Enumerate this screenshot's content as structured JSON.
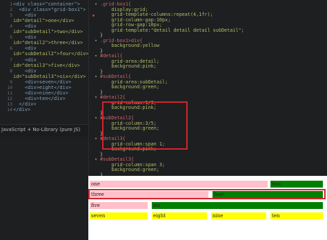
{
  "html_editor": {
    "lines": [
      {
        "n": "1",
        "text": "<div class=\"container\">"
      },
      {
        "n": "2",
        "text": "  <div class=\"grid-box1\">"
      },
      {
        "n": "3",
        "text": "    <div"
      },
      {
        "n": "",
        "text": "id=\"detail\">one</div>"
      },
      {
        "n": "4",
        "text": "    <div"
      },
      {
        "n": "",
        "text": "id=\"subDetail\">two</div>"
      },
      {
        "n": "5",
        "text": "    <div"
      },
      {
        "n": "",
        "text": "id=\"detail2\">three</div>"
      },
      {
        "n": "6",
        "text": "    <div"
      },
      {
        "n": "",
        "text": "id=\"subDetail2\">four</div>"
      },
      {
        "n": "7",
        "text": "    <div"
      },
      {
        "n": "",
        "text": "id=\"detail3\">five</div>"
      },
      {
        "n": "8",
        "text": "    <div"
      },
      {
        "n": "",
        "text": "id=\"subDetail3\">six</div>"
      },
      {
        "n": "9",
        "text": "    <div>seven</div>"
      },
      {
        "n": "10",
        "text": "    <div>eight</div>"
      },
      {
        "n": "11",
        "text": "    <div>nine</div>"
      },
      {
        "n": "12",
        "text": "    <div>ten</div>"
      },
      {
        "n": "13",
        "text": "  </div>"
      },
      {
        "n": "14",
        "text": "</div>"
      }
    ]
  },
  "js_bar": {
    "label": "JavaScript + No-Library (pure JS)",
    "icon": "chevron-down-icon"
  },
  "css_editor": {
    "lines": [
      {
        "fold": "▾",
        "text": ".grid-box1{"
      },
      {
        "fold": "",
        "text": "    display:grid;"
      },
      {
        "fold": "",
        "text": "    grid-template-columns:repeat(4,1fr);"
      },
      {
        "fold": "",
        "text": "    grid-column-gap:10px;"
      },
      {
        "fold": "",
        "text": "    grid-row-gap:10px;"
      },
      {
        "fold": "",
        "text": "    grid-template:\"detail detail detail subDetail\";"
      },
      {
        "fold": "",
        "text": "}"
      },
      {
        "fold": "▾",
        "text": ".grid-box1>div{"
      },
      {
        "fold": "",
        "text": "    background:yellow"
      },
      {
        "fold": "",
        "text": "}"
      },
      {
        "fold": "▾",
        "text": "#detail{"
      },
      {
        "fold": "",
        "text": "    grid-area:detail;"
      },
      {
        "fold": "",
        "text": "    background:pink;"
      },
      {
        "fold": "",
        "text": "}"
      },
      {
        "fold": "▾",
        "text": "#subDetail{"
      },
      {
        "fold": "",
        "text": "    grid-area:subDetail;"
      },
      {
        "fold": "",
        "text": "    background:green;"
      },
      {
        "fold": "",
        "text": "}"
      },
      {
        "fold": "▾",
        "text": "#detail2{"
      },
      {
        "fold": "",
        "text": "    grid-column:1/3;"
      },
      {
        "fold": "",
        "text": "    background:pink;"
      },
      {
        "fold": "",
        "text": "}"
      },
      {
        "fold": "▾",
        "text": "#subDetail2{"
      },
      {
        "fold": "",
        "text": "    grid-column:3/5;"
      },
      {
        "fold": "",
        "text": "    background:green;"
      },
      {
        "fold": "",
        "text": "}"
      },
      {
        "fold": "▾",
        "text": "#detail3{"
      },
      {
        "fold": "",
        "text": "    grid-column:span 1;"
      },
      {
        "fold": "",
        "text": "    background:pink;"
      },
      {
        "fold": "",
        "text": "}"
      },
      {
        "fold": "▾",
        "text": "#subDetail3{"
      },
      {
        "fold": "",
        "text": "    grid-column:span 3;"
      },
      {
        "fold": "",
        "text": "    background:green;"
      },
      {
        "fold": "",
        "text": "}"
      }
    ]
  },
  "output": {
    "cells": [
      "one",
      "two",
      "three",
      "four",
      "five",
      "six",
      "seven",
      "eight",
      "nine",
      "ten"
    ],
    "colors": {
      "pink": "#ffc0cb",
      "green": "#008000",
      "yellow": "#ffff00"
    }
  },
  "accent": {
    "highlight": "#d6232a",
    "breakpoint": "#cc3b3b"
  }
}
